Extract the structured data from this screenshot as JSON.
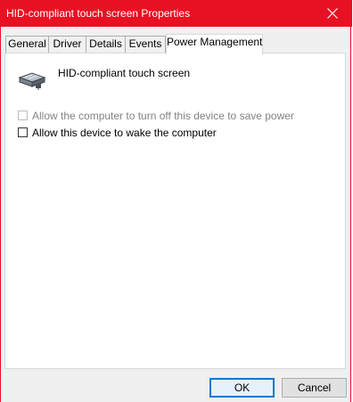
{
  "window": {
    "title": "HID-compliant touch screen Properties",
    "accent_color": "#e81123",
    "close_icon": "close-icon"
  },
  "tabs": [
    {
      "label": "General",
      "active": false
    },
    {
      "label": "Driver",
      "active": false
    },
    {
      "label": "Details",
      "active": false
    },
    {
      "label": "Events",
      "active": false
    },
    {
      "label": "Power Management",
      "active": true
    }
  ],
  "device": {
    "icon": "touch-screen-device-icon",
    "name": "HID-compliant touch screen"
  },
  "options": [
    {
      "label": "Allow the computer to turn off this device to save power",
      "checked": false,
      "enabled": false
    },
    {
      "label": "Allow this device to wake the computer",
      "checked": false,
      "enabled": true
    }
  ],
  "buttons": {
    "ok": "OK",
    "cancel": "Cancel"
  }
}
